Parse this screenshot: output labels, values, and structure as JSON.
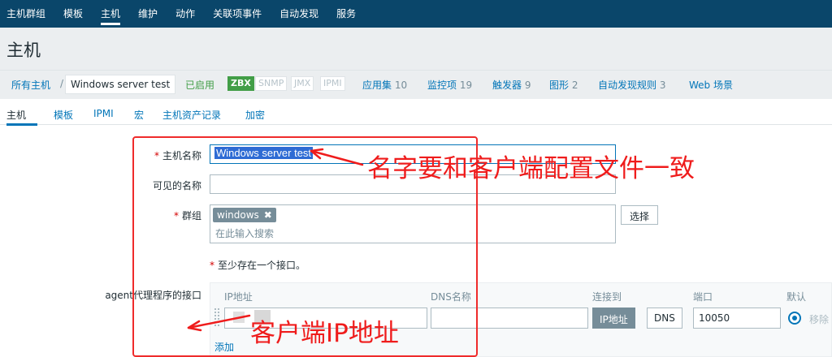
{
  "topnav": {
    "items": [
      "主机群组",
      "模板",
      "主机",
      "维护",
      "动作",
      "关联项事件",
      "自动发现",
      "服务"
    ]
  },
  "page": {
    "title": "主机"
  },
  "breadcrumb": {
    "all_hosts": "所有主机",
    "sep": "/",
    "current_host": "Windows server test"
  },
  "status": {
    "enabled": "已启用"
  },
  "availability": [
    "ZBX",
    "SNMP",
    "JMX",
    "IPMI"
  ],
  "sublinks": [
    {
      "label": "应用集",
      "count": "10"
    },
    {
      "label": "监控项",
      "count": "19"
    },
    {
      "label": "触发器",
      "count": "9"
    },
    {
      "label": "图形",
      "count": "2"
    },
    {
      "label": "自动发现规则",
      "count": "3"
    },
    {
      "label": "Web 场景",
      "count": ""
    }
  ],
  "tabs": [
    "主机",
    "模板",
    "IPMI",
    "宏",
    "主机资产记录",
    "加密"
  ],
  "form": {
    "required_mark": "*",
    "host_name_label": "主机名称",
    "host_name_value": "Windows server test",
    "visible_name_label": "可见的名称",
    "visible_name_value": "",
    "groups_label": "群组",
    "group_chip": "windows",
    "group_chip_remove": "✖",
    "group_placeholder": "在此输入搜索",
    "select_button": "选择",
    "interface_notice": "至少存在一个接口。",
    "agent_iface_label": "agent代理程序的接口"
  },
  "interface": {
    "headers": {
      "ip": "IP地址",
      "dns": "DNS名称",
      "connect_to": "连接到",
      "port": "端口",
      "default": "默认"
    },
    "connect_ip": "IP地址",
    "connect_dns": "DNS",
    "port_value": "10050",
    "remove": "移除",
    "add": "添加"
  },
  "annotations": {
    "name_note": "名字要和客户端配置文件一致",
    "ip_note": "客户端IP地址",
    "color": "#ef1c1c"
  }
}
